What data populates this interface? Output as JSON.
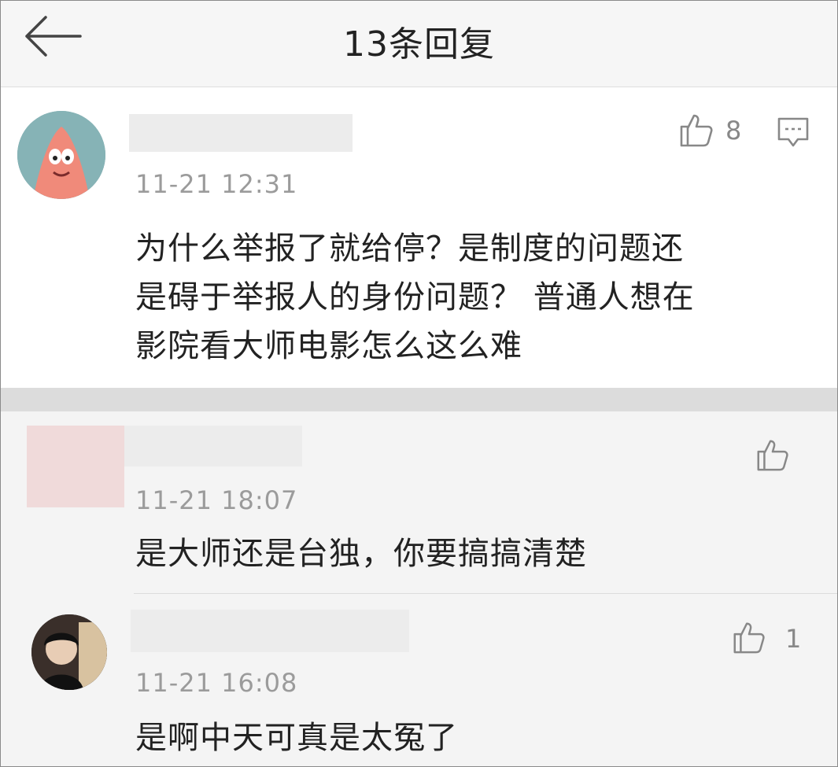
{
  "header": {
    "title": "13条回复"
  },
  "main_comment": {
    "time": "11-21 12:31",
    "like_count": "8",
    "content_lines": [
      "为什么举报了就给停？是制度的问题还",
      "是碍于举报人的身份问题？ 普通人想在",
      "影院看大师电影怎么这么难"
    ]
  },
  "replies": [
    {
      "time": "11-21 18:07",
      "like_count": "",
      "content": "是大师还是台独，你要搞搞清楚"
    },
    {
      "time": "11-21 16:08",
      "like_count": "1",
      "content": "是啊中天可真是太冤了"
    }
  ],
  "icons": {
    "back": "arrow-left-icon",
    "like": "thumbs-up-icon",
    "reply": "comment-icon"
  }
}
